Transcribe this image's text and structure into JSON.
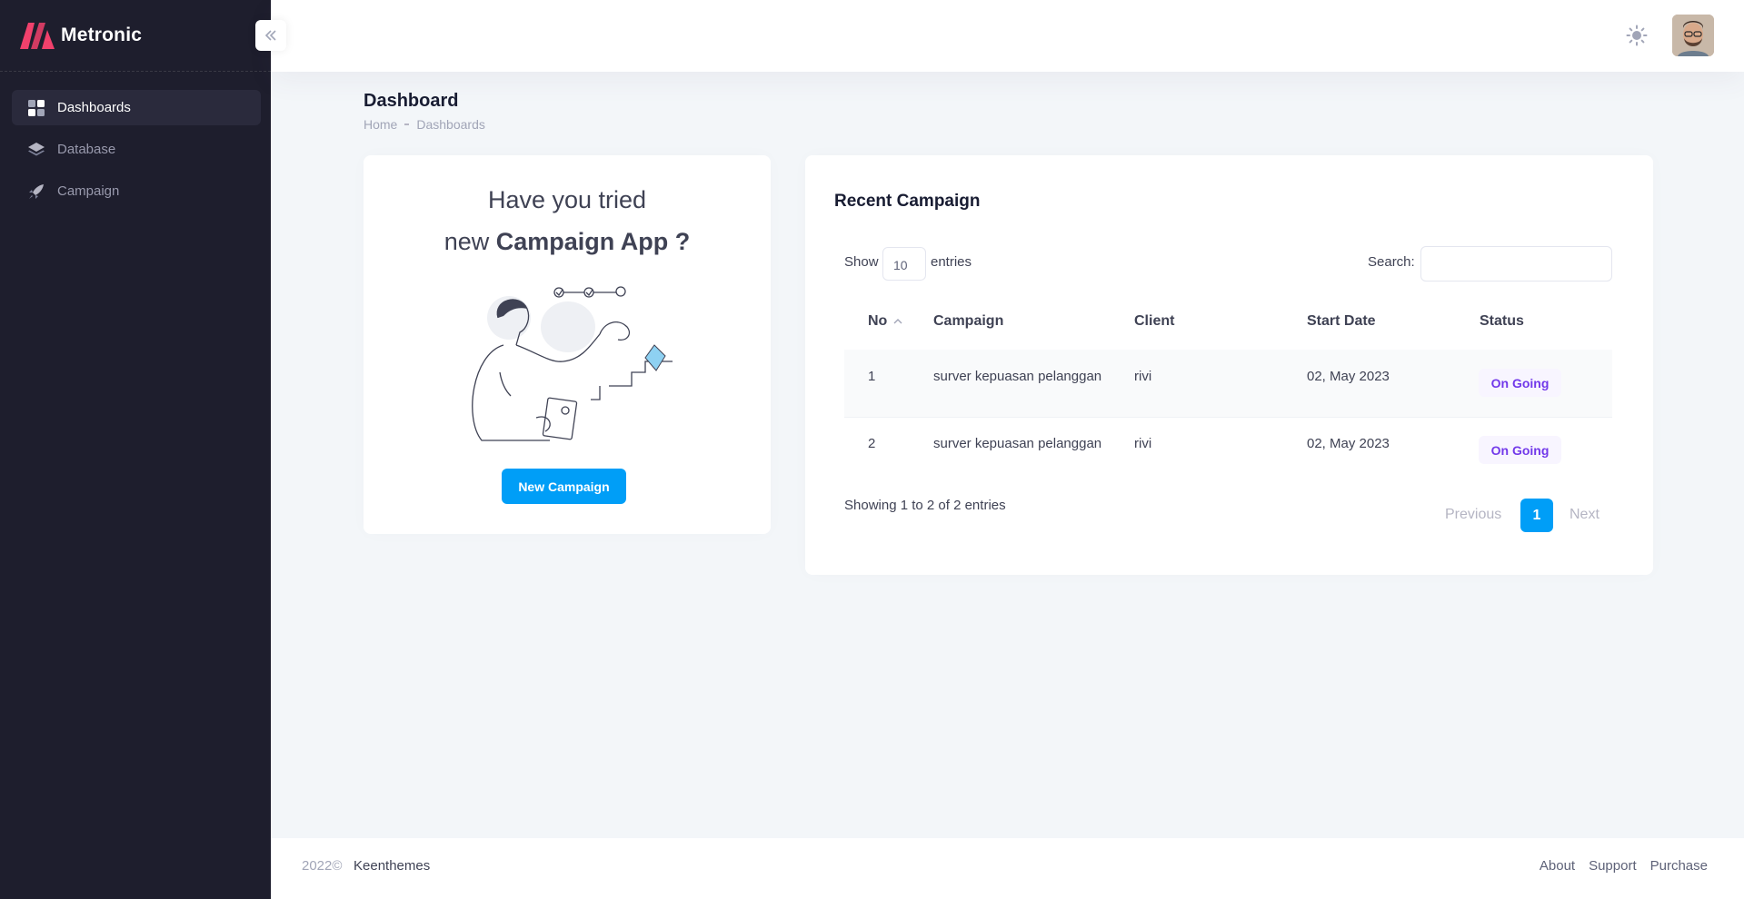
{
  "brand": {
    "name": "Metronic",
    "accent": "#f1416c"
  },
  "sidebar": {
    "items": [
      {
        "label": "Dashboards",
        "icon": "dashboard-grid-icon",
        "active": true
      },
      {
        "label": "Database",
        "icon": "layers-icon",
        "active": false
      },
      {
        "label": "Campaign",
        "icon": "rocket-icon",
        "active": false
      }
    ]
  },
  "header": {
    "theme_icon": "sun-icon",
    "avatar": "user-avatar"
  },
  "toolbar": {
    "title": "Dashboard",
    "breadcrumb": [
      "Home",
      "Dashboards"
    ]
  },
  "promo": {
    "line1": "Have you tried",
    "line2_prefix": "new ",
    "line2_strong": "Campaign App ?",
    "button_label": "New Campaign"
  },
  "campaigns": {
    "title": "Recent Campaign",
    "show_label": "Show",
    "page_size": "10",
    "entries_label": "entries",
    "search_label": "Search:",
    "search_value": "",
    "columns": [
      "No",
      "Campaign",
      "Client",
      "Start Date",
      "Status"
    ],
    "rows": [
      {
        "no": "1",
        "campaign": "surver kepuasan pelanggan",
        "client": "rivi",
        "start_date": "02, May 2023",
        "status": "On Going"
      },
      {
        "no": "2",
        "campaign": "surver kepuasan pelanggan",
        "client": "rivi",
        "start_date": "02, May 2023",
        "status": "On Going"
      }
    ],
    "info": "Showing 1 to 2 of 2 entries",
    "pagination": {
      "previous": "Previous",
      "current": "1",
      "next": "Next"
    }
  },
  "footer": {
    "year": "2022©",
    "company": "Keenthemes",
    "links": [
      "About",
      "Support",
      "Purchase"
    ]
  },
  "colors": {
    "sidebar_bg": "#1e1e2d",
    "primary": "#009ef7",
    "badge_text": "#7239ea",
    "badge_bg": "#f8f5ff",
    "page_bg": "#f3f6f9"
  }
}
